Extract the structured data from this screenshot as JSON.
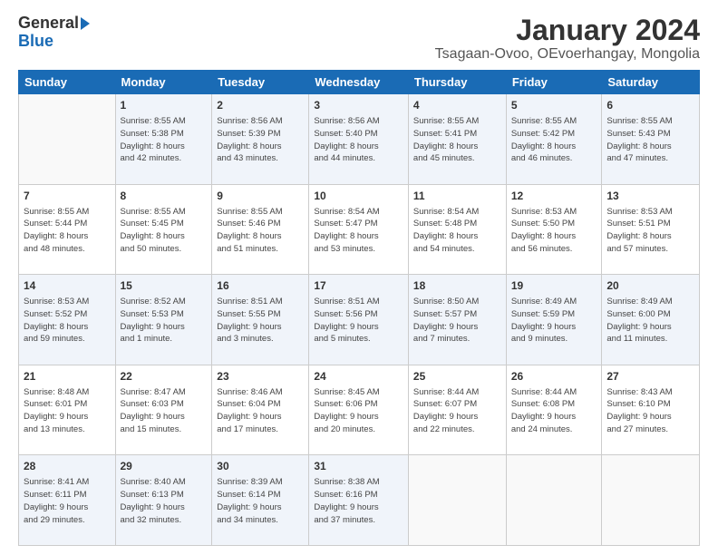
{
  "logo": {
    "general": "General",
    "blue": "Blue"
  },
  "title": "January 2024",
  "subtitle": "Tsagaan-Ovoo, OEvoerhangay, Mongolia",
  "headers": [
    "Sunday",
    "Monday",
    "Tuesday",
    "Wednesday",
    "Thursday",
    "Friday",
    "Saturday"
  ],
  "rows": [
    [
      {
        "day": "",
        "info": ""
      },
      {
        "day": "1",
        "info": "Sunrise: 8:55 AM\nSunset: 5:38 PM\nDaylight: 8 hours\nand 42 minutes."
      },
      {
        "day": "2",
        "info": "Sunrise: 8:56 AM\nSunset: 5:39 PM\nDaylight: 8 hours\nand 43 minutes."
      },
      {
        "day": "3",
        "info": "Sunrise: 8:56 AM\nSunset: 5:40 PM\nDaylight: 8 hours\nand 44 minutes."
      },
      {
        "day": "4",
        "info": "Sunrise: 8:55 AM\nSunset: 5:41 PM\nDaylight: 8 hours\nand 45 minutes."
      },
      {
        "day": "5",
        "info": "Sunrise: 8:55 AM\nSunset: 5:42 PM\nDaylight: 8 hours\nand 46 minutes."
      },
      {
        "day": "6",
        "info": "Sunrise: 8:55 AM\nSunset: 5:43 PM\nDaylight: 8 hours\nand 47 minutes."
      }
    ],
    [
      {
        "day": "7",
        "info": "Sunrise: 8:55 AM\nSunset: 5:44 PM\nDaylight: 8 hours\nand 48 minutes."
      },
      {
        "day": "8",
        "info": "Sunrise: 8:55 AM\nSunset: 5:45 PM\nDaylight: 8 hours\nand 50 minutes."
      },
      {
        "day": "9",
        "info": "Sunrise: 8:55 AM\nSunset: 5:46 PM\nDaylight: 8 hours\nand 51 minutes."
      },
      {
        "day": "10",
        "info": "Sunrise: 8:54 AM\nSunset: 5:47 PM\nDaylight: 8 hours\nand 53 minutes."
      },
      {
        "day": "11",
        "info": "Sunrise: 8:54 AM\nSunset: 5:48 PM\nDaylight: 8 hours\nand 54 minutes."
      },
      {
        "day": "12",
        "info": "Sunrise: 8:53 AM\nSunset: 5:50 PM\nDaylight: 8 hours\nand 56 minutes."
      },
      {
        "day": "13",
        "info": "Sunrise: 8:53 AM\nSunset: 5:51 PM\nDaylight: 8 hours\nand 57 minutes."
      }
    ],
    [
      {
        "day": "14",
        "info": "Sunrise: 8:53 AM\nSunset: 5:52 PM\nDaylight: 8 hours\nand 59 minutes."
      },
      {
        "day": "15",
        "info": "Sunrise: 8:52 AM\nSunset: 5:53 PM\nDaylight: 9 hours\nand 1 minute."
      },
      {
        "day": "16",
        "info": "Sunrise: 8:51 AM\nSunset: 5:55 PM\nDaylight: 9 hours\nand 3 minutes."
      },
      {
        "day": "17",
        "info": "Sunrise: 8:51 AM\nSunset: 5:56 PM\nDaylight: 9 hours\nand 5 minutes."
      },
      {
        "day": "18",
        "info": "Sunrise: 8:50 AM\nSunset: 5:57 PM\nDaylight: 9 hours\nand 7 minutes."
      },
      {
        "day": "19",
        "info": "Sunrise: 8:49 AM\nSunset: 5:59 PM\nDaylight: 9 hours\nand 9 minutes."
      },
      {
        "day": "20",
        "info": "Sunrise: 8:49 AM\nSunset: 6:00 PM\nDaylight: 9 hours\nand 11 minutes."
      }
    ],
    [
      {
        "day": "21",
        "info": "Sunrise: 8:48 AM\nSunset: 6:01 PM\nDaylight: 9 hours\nand 13 minutes."
      },
      {
        "day": "22",
        "info": "Sunrise: 8:47 AM\nSunset: 6:03 PM\nDaylight: 9 hours\nand 15 minutes."
      },
      {
        "day": "23",
        "info": "Sunrise: 8:46 AM\nSunset: 6:04 PM\nDaylight: 9 hours\nand 17 minutes."
      },
      {
        "day": "24",
        "info": "Sunrise: 8:45 AM\nSunset: 6:06 PM\nDaylight: 9 hours\nand 20 minutes."
      },
      {
        "day": "25",
        "info": "Sunrise: 8:44 AM\nSunset: 6:07 PM\nDaylight: 9 hours\nand 22 minutes."
      },
      {
        "day": "26",
        "info": "Sunrise: 8:44 AM\nSunset: 6:08 PM\nDaylight: 9 hours\nand 24 minutes."
      },
      {
        "day": "27",
        "info": "Sunrise: 8:43 AM\nSunset: 6:10 PM\nDaylight: 9 hours\nand 27 minutes."
      }
    ],
    [
      {
        "day": "28",
        "info": "Sunrise: 8:41 AM\nSunset: 6:11 PM\nDaylight: 9 hours\nand 29 minutes."
      },
      {
        "day": "29",
        "info": "Sunrise: 8:40 AM\nSunset: 6:13 PM\nDaylight: 9 hours\nand 32 minutes."
      },
      {
        "day": "30",
        "info": "Sunrise: 8:39 AM\nSunset: 6:14 PM\nDaylight: 9 hours\nand 34 minutes."
      },
      {
        "day": "31",
        "info": "Sunrise: 8:38 AM\nSunset: 6:16 PM\nDaylight: 9 hours\nand 37 minutes."
      },
      {
        "day": "",
        "info": ""
      },
      {
        "day": "",
        "info": ""
      },
      {
        "day": "",
        "info": ""
      }
    ]
  ]
}
